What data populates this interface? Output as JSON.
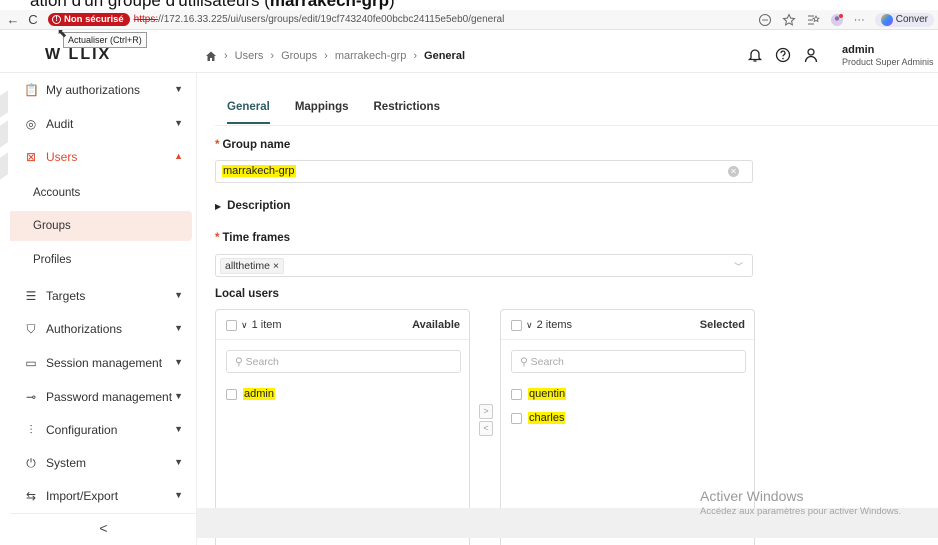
{
  "caption": {
    "text_prefix": "ation d'un groupe d'utilisateurs (",
    "text_bold": "marrakech-grp",
    "text_suffix": ")"
  },
  "browser": {
    "back_icon": "←",
    "reload_icon": "C",
    "security_badge": "Non sécurisé",
    "url_scheme": "https:",
    "url_rest": "//172.16.33.225/ui/users/groups/edit/19cf743240fe00bcbc24115e5eb0/general",
    "tooltip": "Actualiser (Ctrl+R)",
    "conversation_label": "Conver"
  },
  "header": {
    "logo_text": "W  LLIX",
    "breadcrumb": {
      "home_icon": "home-icon",
      "items": [
        "Users",
        "Groups",
        "marrakech-grp"
      ],
      "current": "General"
    },
    "user": {
      "name": "admin",
      "role": "Product Super Adminis"
    }
  },
  "sidebar": {
    "items": [
      {
        "label": "My authorizations",
        "icon": "clipboard-icon",
        "glyph": "📋"
      },
      {
        "label": "Audit",
        "icon": "eye-icon",
        "glyph": "◎"
      },
      {
        "label": "Users",
        "icon": "users-icon",
        "glyph": "👥"
      },
      {
        "label": "Targets",
        "icon": "list-icon",
        "glyph": "☰"
      },
      {
        "label": "Authorizations",
        "icon": "shield-check-icon",
        "glyph": "⛉"
      },
      {
        "label": "Session management",
        "icon": "monitor-icon",
        "glyph": "▭"
      },
      {
        "label": "Password management",
        "icon": "key-icon",
        "glyph": "⊸"
      },
      {
        "label": "Configuration",
        "icon": "sliders-icon",
        "glyph": "⫶"
      },
      {
        "label": "System",
        "icon": "power-icon",
        "glyph": "⏻"
      },
      {
        "label": "Import/Export",
        "icon": "transfer-icon",
        "glyph": "⇆"
      }
    ],
    "users_sub": [
      "Accounts",
      "Groups",
      "Profiles"
    ],
    "collapse_label": "<"
  },
  "main": {
    "tabs": [
      "General",
      "Mappings",
      "Restrictions"
    ],
    "group_name": {
      "label": "Group name",
      "value": "marrakech-grp"
    },
    "description_label": "Description",
    "time_frames": {
      "label": "Time frames",
      "chip": "allthetime ×"
    },
    "local_users": {
      "label": "Local users",
      "available": {
        "count": "1 item",
        "title": "Available",
        "search_placeholder": "Search",
        "items": [
          "admin"
        ]
      },
      "selected": {
        "count": "2 items",
        "title": "Selected",
        "search_placeholder": "Search",
        "items": [
          "quentin",
          "charles"
        ]
      },
      "move_right": ">",
      "move_left": "<"
    }
  },
  "watermark": {
    "title": "Activer Windows",
    "subtitle": "Accédez aux paramètres pour activer Windows."
  },
  "colors": {
    "accent": "#e24a2c",
    "tab_active": "#2c5e63",
    "highlight": "#fff200",
    "insecure": "#c4161c"
  }
}
